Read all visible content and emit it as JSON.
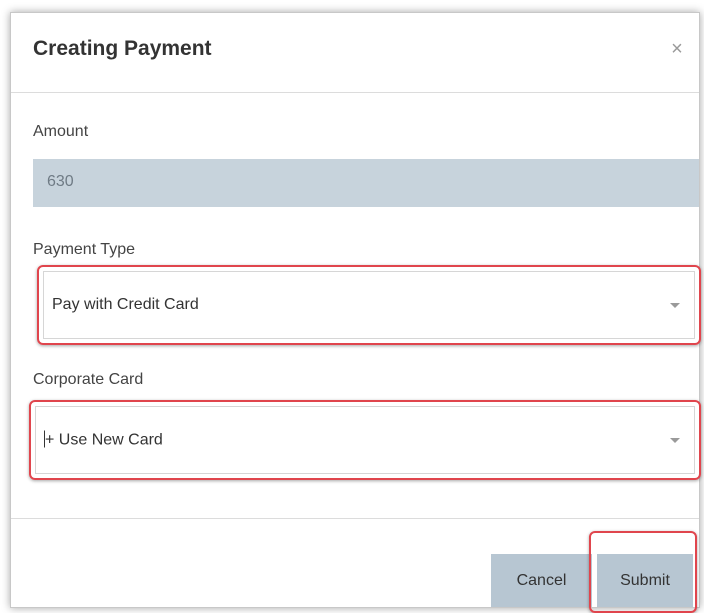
{
  "dialog": {
    "title": "Creating Payment",
    "close_symbol": "×"
  },
  "form": {
    "amount_label": "Amount",
    "amount_value": "630",
    "payment_type_label": "Payment Type",
    "payment_type_selected": "Pay with Credit Card",
    "corporate_card_label": "Corporate Card",
    "corporate_card_selected": "+ Use New Card"
  },
  "actions": {
    "cancel_label": "Cancel",
    "submit_label": "Submit"
  },
  "icons": {
    "close": "close-icon",
    "dropdown": "chevron-down-icon"
  },
  "colors": {
    "highlight": "#e0454d",
    "button_bg": "#b7c6d2",
    "readonly_bg": "#c7d3dc"
  }
}
